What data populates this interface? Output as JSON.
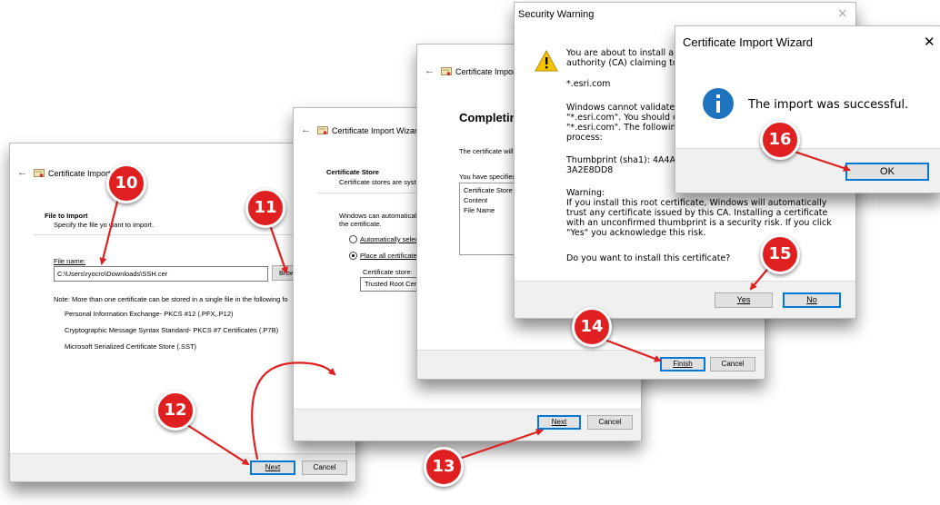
{
  "w1": {
    "back": "←",
    "title": "Certificate Import",
    "section_title": "File to Import",
    "section_desc": "Specify the file yo want to import.",
    "file_label": "File name:",
    "file_value": "C:\\Users\\ryocro\\Downloads\\SSH.cer",
    "browse": "Brow",
    "note": "Note:  More than one certificate can be stored in a single file in the following fo",
    "formats": [
      "Personal Information Exchange- PKCS #12 (.PFX,.P12)",
      "Cryptographic Message Syntax Standard- PKCS #7 Certificates (.P7B)",
      "Microsoft Serialized Certificate Store (.SST)"
    ],
    "next": "Next",
    "cancel": "Cancel"
  },
  "w2": {
    "back": "←",
    "title": "Certificate Import Wizard",
    "section_title": "Certificate Store",
    "section_desc": "Certificate stores are syst",
    "desc1": "Windows can automaticall",
    "desc2": "the certificate.",
    "radio1": "Automatically selec",
    "radio2": "Place all certificates",
    "store_label": "Certificate store:",
    "store_value": "Trusted Root Cer",
    "next": "Next",
    "cancel": "Cancel"
  },
  "w3": {
    "back": "←",
    "title": "Certificate Impor",
    "heading": "Completing",
    "text1": "The certificate will",
    "text2": "You have specified",
    "list": [
      "Certificate Store",
      "Content",
      "File Name"
    ],
    "finish": "Finish",
    "cancel": "Cancel"
  },
  "w4": {
    "title": "Security Warning",
    "close": "×",
    "p1a": "You are about to install a",
    "p1b": "authority (CA) claiming to",
    "domain": "*.esri.com",
    "p2a": "Windows cannot validate",
    "p2b": "\"*.esri.com\". You should c",
    "p2c": "\"*.esri.com\". The followin",
    "p2d": "process:",
    "thumb_a": "Thumbprint (sha1): 4A4A8",
    "thumb_b": "3A2E8DD8",
    "warn_title": "Warning:",
    "warn1": "If you install this root certificate, Windows will automatically",
    "warn2": "trust any certificate issued by this CA. Installing a certificate",
    "warn3": "with an unconfirmed thumbprint is a security risk. If you click",
    "warn4": "\"Yes\" you acknowledge this risk.",
    "question": "Do you want to install this certificate?",
    "yes": "Yes",
    "no": "No"
  },
  "w5": {
    "title": "Certificate Import Wizard",
    "close": "✕",
    "message": "The import was successful.",
    "ok": "OK"
  },
  "badges": [
    "10",
    "11",
    "12",
    "13",
    "14",
    "15",
    "16"
  ],
  "colors": {
    "badge": "#e02020",
    "info": "#1e73be",
    "warning": "#f5c400",
    "accent": "#0078d7"
  }
}
